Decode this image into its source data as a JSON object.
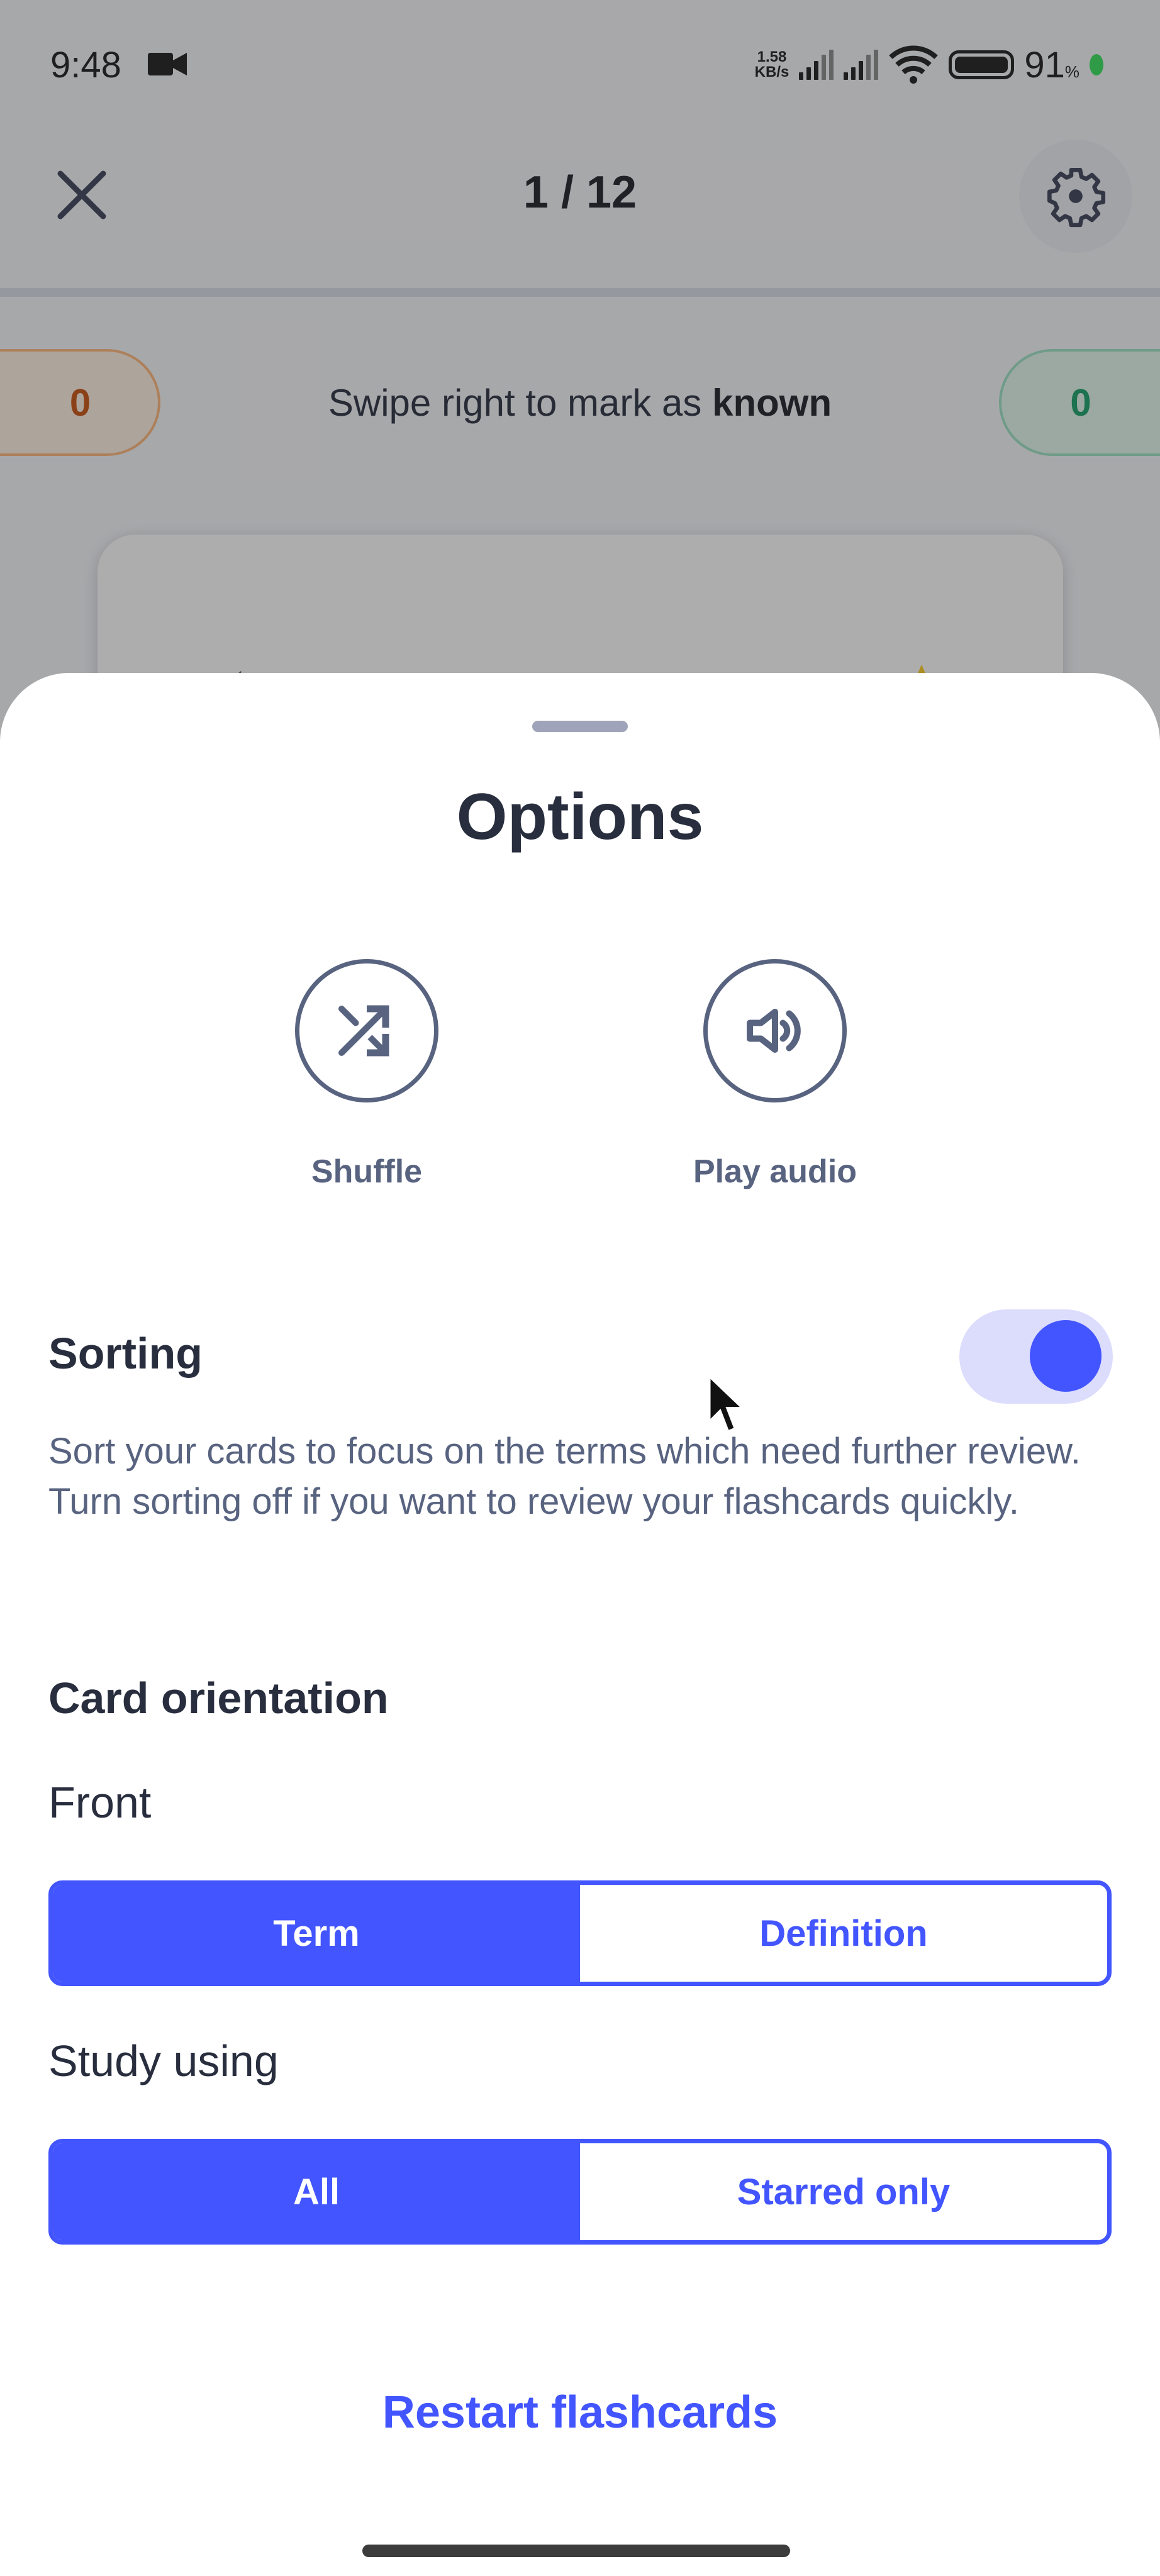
{
  "status_bar": {
    "time": "9:48",
    "net_speed_value": "1.58",
    "net_speed_unit": "KB/s",
    "battery_percent": "91",
    "battery_unit": "%",
    "icons": [
      "video-camera-icon",
      "signal-icon",
      "signal-icon",
      "wifi-icon",
      "battery-icon",
      "charging-dot-icon"
    ]
  },
  "header": {
    "close_icon": "close-icon",
    "progress": "1 / 12",
    "settings_icon": "gear-icon"
  },
  "study_progress": {
    "still_learning_count": "0",
    "known_count": "0",
    "hint_prefix": "Swipe right to mark as ",
    "hint_emphasis": "known"
  },
  "flashcard": {
    "icons": [
      "audio-icon",
      "star-icon"
    ]
  },
  "options_sheet": {
    "title": "Options",
    "quick_actions": [
      {
        "label": "Shuffle",
        "icon": "shuffle-icon"
      },
      {
        "label": "Play audio",
        "icon": "speaker-icon"
      }
    ],
    "sorting": {
      "title": "Sorting",
      "enabled": true,
      "description": "Sort your cards to focus on the terms which need further review. Turn sorting off if you want to review your flashcards quickly."
    },
    "card_orientation": {
      "title": "Card orientation",
      "front_label": "Front",
      "front_options": [
        "Term",
        "Definition"
      ],
      "front_selected": "Term",
      "study_label": "Study using",
      "study_options": [
        "All",
        "Starred only"
      ],
      "study_selected": "All"
    },
    "restart_label": "Restart flashcards"
  },
  "colors": {
    "accent": "#4255ff",
    "toggle_track": "#dcdcfd",
    "text_primary": "#282e3e",
    "text_secondary": "#586380",
    "learning_orange": "#c9520d",
    "known_green": "#18a06a"
  }
}
